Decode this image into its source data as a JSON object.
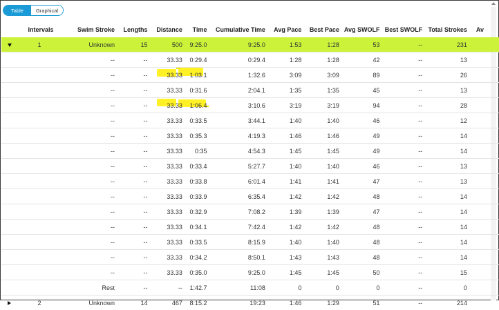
{
  "view_toggle": {
    "table": "Table",
    "graphical": "Graphical"
  },
  "colors": {
    "accent": "#1a9ad6",
    "row_highlight": "#ccf33a",
    "annotation": "#ffef00"
  },
  "headers": [
    "",
    "Intervals",
    "Swim Stroke",
    "Lengths",
    "Distance",
    "Time",
    "Cumulative Time",
    "Avg Pace",
    "Best Pace",
    "Avg SWOLF",
    "Best SWOLF",
    "Total Strokes",
    "Av"
  ],
  "interval_1": {
    "toggle_icon": "caret-down-icon",
    "interval": "1",
    "stroke": "Unknown",
    "lengths": "15",
    "distance": "500",
    "time": "9:25.0",
    "cumulative": "9:25.0",
    "avg_pace": "1:53",
    "best_pace": "1:28",
    "avg_swolf": "53",
    "best_swolf": "--",
    "total_strokes": "231"
  },
  "lengths": [
    {
      "stroke": "--",
      "lengths": "--",
      "distance": "33.33",
      "time": "0:29.4",
      "cumulative": "0:29.4",
      "avg_pace": "1:28",
      "best_pace": "1:28",
      "avg_swolf": "42",
      "best_swolf": "--",
      "total_strokes": "13"
    },
    {
      "stroke": "--",
      "lengths": "--",
      "distance": "33.33",
      "time": "1:03.1",
      "cumulative": "1:32.6",
      "avg_pace": "3:09",
      "best_pace": "3:09",
      "avg_swolf": "89",
      "best_swolf": "--",
      "total_strokes": "26"
    },
    {
      "stroke": "--",
      "lengths": "--",
      "distance": "33.33",
      "time": "0:31.6",
      "cumulative": "2:04.1",
      "avg_pace": "1:35",
      "best_pace": "1:35",
      "avg_swolf": "45",
      "best_swolf": "--",
      "total_strokes": "13"
    },
    {
      "stroke": "--",
      "lengths": "--",
      "distance": "33.33",
      "time": "1:06.4",
      "cumulative": "3:10.6",
      "avg_pace": "3:19",
      "best_pace": "3:19",
      "avg_swolf": "94",
      "best_swolf": "--",
      "total_strokes": "28"
    },
    {
      "stroke": "--",
      "lengths": "--",
      "distance": "33.33",
      "time": "0:33.5",
      "cumulative": "3:44.1",
      "avg_pace": "1:40",
      "best_pace": "1:40",
      "avg_swolf": "46",
      "best_swolf": "--",
      "total_strokes": "12"
    },
    {
      "stroke": "--",
      "lengths": "--",
      "distance": "33.33",
      "time": "0:35.3",
      "cumulative": "4:19.3",
      "avg_pace": "1:46",
      "best_pace": "1:46",
      "avg_swolf": "49",
      "best_swolf": "--",
      "total_strokes": "14"
    },
    {
      "stroke": "--",
      "lengths": "--",
      "distance": "33.33",
      "time": "0:35",
      "cumulative": "4:54.3",
      "avg_pace": "1:45",
      "best_pace": "1:45",
      "avg_swolf": "49",
      "best_swolf": "--",
      "total_strokes": "14"
    },
    {
      "stroke": "--",
      "lengths": "--",
      "distance": "33.33",
      "time": "0:33.4",
      "cumulative": "5:27.7",
      "avg_pace": "1:40",
      "best_pace": "1:40",
      "avg_swolf": "46",
      "best_swolf": "--",
      "total_strokes": "13"
    },
    {
      "stroke": "--",
      "lengths": "--",
      "distance": "33.33",
      "time": "0:33.8",
      "cumulative": "6:01.4",
      "avg_pace": "1:41",
      "best_pace": "1:41",
      "avg_swolf": "47",
      "best_swolf": "--",
      "total_strokes": "13"
    },
    {
      "stroke": "--",
      "lengths": "--",
      "distance": "33.33",
      "time": "0:33.9",
      "cumulative": "6:35.4",
      "avg_pace": "1:42",
      "best_pace": "1:42",
      "avg_swolf": "48",
      "best_swolf": "--",
      "total_strokes": "14"
    },
    {
      "stroke": "--",
      "lengths": "--",
      "distance": "33.33",
      "time": "0:32.9",
      "cumulative": "7:08.2",
      "avg_pace": "1:39",
      "best_pace": "1:39",
      "avg_swolf": "47",
      "best_swolf": "--",
      "total_strokes": "14"
    },
    {
      "stroke": "--",
      "lengths": "--",
      "distance": "33.33",
      "time": "0:34.1",
      "cumulative": "7:42.4",
      "avg_pace": "1:42",
      "best_pace": "1:42",
      "avg_swolf": "48",
      "best_swolf": "--",
      "total_strokes": "14"
    },
    {
      "stroke": "--",
      "lengths": "--",
      "distance": "33.33",
      "time": "0:33.5",
      "cumulative": "8:15.9",
      "avg_pace": "1:40",
      "best_pace": "1:40",
      "avg_swolf": "48",
      "best_swolf": "--",
      "total_strokes": "14"
    },
    {
      "stroke": "--",
      "lengths": "--",
      "distance": "33.33",
      "time": "0:34.2",
      "cumulative": "8:50.1",
      "avg_pace": "1:43",
      "best_pace": "1:43",
      "avg_swolf": "48",
      "best_swolf": "--",
      "total_strokes": "14"
    },
    {
      "stroke": "--",
      "lengths": "--",
      "distance": "33.33",
      "time": "0:35.0",
      "cumulative": "9:25.0",
      "avg_pace": "1:45",
      "best_pace": "1:45",
      "avg_swolf": "50",
      "best_swolf": "--",
      "total_strokes": "15"
    }
  ],
  "rest": {
    "stroke": "Rest",
    "lengths": "--",
    "distance": "--",
    "time": "1:42.7",
    "cumulative": "11:08",
    "avg_pace": "0",
    "best_pace": "0",
    "avg_swolf": "0",
    "best_swolf": "--",
    "total_strokes": "0"
  },
  "interval_2": {
    "toggle_icon": "caret-right-icon",
    "interval": "2",
    "stroke": "Unknown",
    "lengths": "14",
    "distance": "467",
    "time": "8:15.2",
    "cumulative": "19:23",
    "avg_pace": "1:46",
    "best_pace": "1:29",
    "avg_swolf": "51",
    "best_swolf": "--",
    "total_strokes": "214"
  }
}
